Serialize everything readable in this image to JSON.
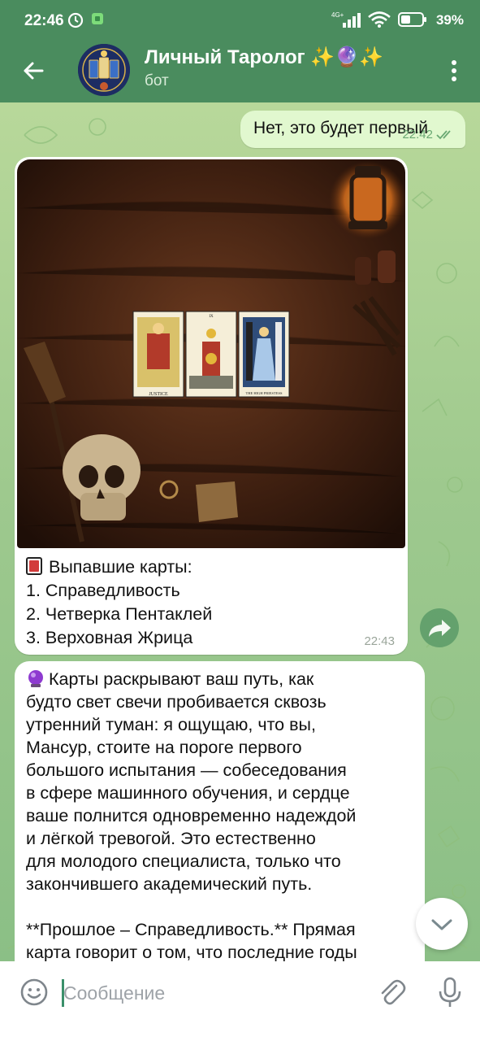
{
  "status_bar": {
    "time": "22:46",
    "signal": "4G+",
    "battery_percent": "39%"
  },
  "header": {
    "title": "Личный Таролог ✨🔮✨",
    "subtitle": "бот"
  },
  "messages": {
    "outgoing": {
      "text": "Нет, это будет первый",
      "time": "22:42"
    },
    "photo": {
      "cards": [
        "JUSTICE",
        "IX",
        "THE HIGH PRIESTESS"
      ],
      "caption_lines": [
        "Выпавшие карты:",
        "1. Справедливость",
        "2. Четверка Пентаклей",
        "3. Верховная Жрица"
      ],
      "time": "22:43"
    },
    "reading": {
      "paragraph1": "Карты раскрывают ваш путь, как\nбудто свет свечи пробивается сквозь\nутренний туман: я ощущаю, что вы,\nМансур, стоите на пороге первого\nбольшого испытания — собеседования\nв сфере машинного обучения, и сердце\nваше полнится одновременно надеждой\nи лёгкой тревогой. Это естественно\nдля молодого специалиста, только что\nзакончившего академический путь.",
      "paragraph2": "**Прошлое – Справедливость.** Прямая\nкарта говорит о том, что последние годы"
    }
  },
  "input": {
    "placeholder": "Сообщение"
  },
  "colors": {
    "header": "#4a8c5e",
    "outgoing_bubble": "#e1f8cf",
    "check": "#6aa873",
    "accent": "#3a8f6a"
  },
  "icons": [
    "back-arrow-icon",
    "more-vertical-icon",
    "share-icon",
    "chevron-down-icon",
    "emoji-icon",
    "attach-icon",
    "mic-icon",
    "crystal-ball-icon"
  ]
}
